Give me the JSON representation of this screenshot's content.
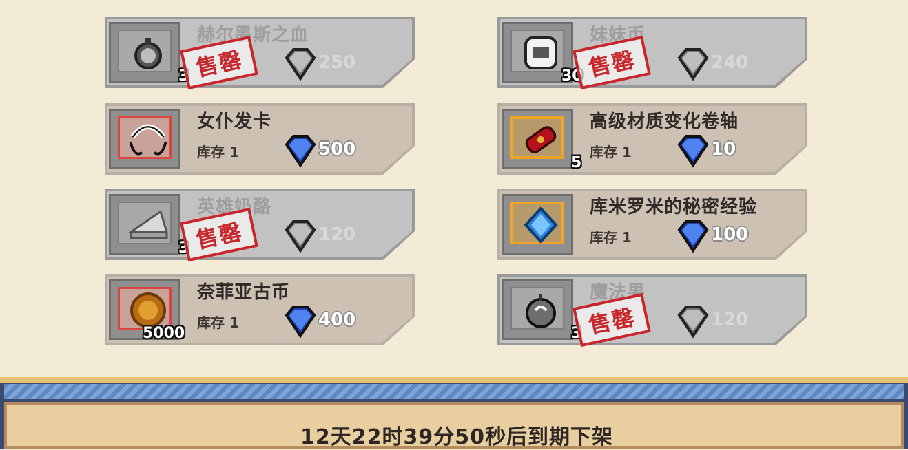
{
  "shop": {
    "left": [
      {
        "name": "赫尔墨斯之血",
        "qty": "3",
        "price": "250",
        "sold_out": true,
        "stamp": "售罄",
        "icon": "potion-flask-icon"
      },
      {
        "name": "女仆发卡",
        "qty": "",
        "stock": "库存 1",
        "price": "500",
        "sold_out": false,
        "icon": "maid-headband-icon"
      },
      {
        "name": "英雄奶酪",
        "qty": "3",
        "price": "120",
        "sold_out": true,
        "stamp": "售罄",
        "icon": "cheese-icon"
      },
      {
        "name": "奈菲亚古币",
        "qty": "5000",
        "stock": "库存 1",
        "price": "400",
        "sold_out": false,
        "icon": "gold-coin-icon"
      }
    ],
    "right": [
      {
        "name": "妹妹币",
        "qty": "30",
        "price": "240",
        "sold_out": true,
        "stamp": "售罄",
        "icon": "sister-coin-icon"
      },
      {
        "name": "高级材质变化卷轴",
        "qty": "5",
        "stock": "库存 1",
        "price": "10",
        "sold_out": false,
        "icon": "red-scroll-icon"
      },
      {
        "name": "库米罗米的秘密经验",
        "qty": "",
        "stock": "库存 1",
        "price": "100",
        "sold_out": false,
        "icon": "blue-crystal-icon"
      },
      {
        "name": "魔法果",
        "qty": "3",
        "price": "120",
        "sold_out": true,
        "stamp": "售罄",
        "icon": "magic-fruit-icon"
      }
    ]
  },
  "footer": {
    "expiry_text": "12天22时39分50秒后到期下架"
  },
  "colors": {
    "background": "#f3ebd6",
    "stamp_red": "#c8262a",
    "gem_blue": "#3a66e0",
    "gem_gray": "#8a8a8a"
  }
}
